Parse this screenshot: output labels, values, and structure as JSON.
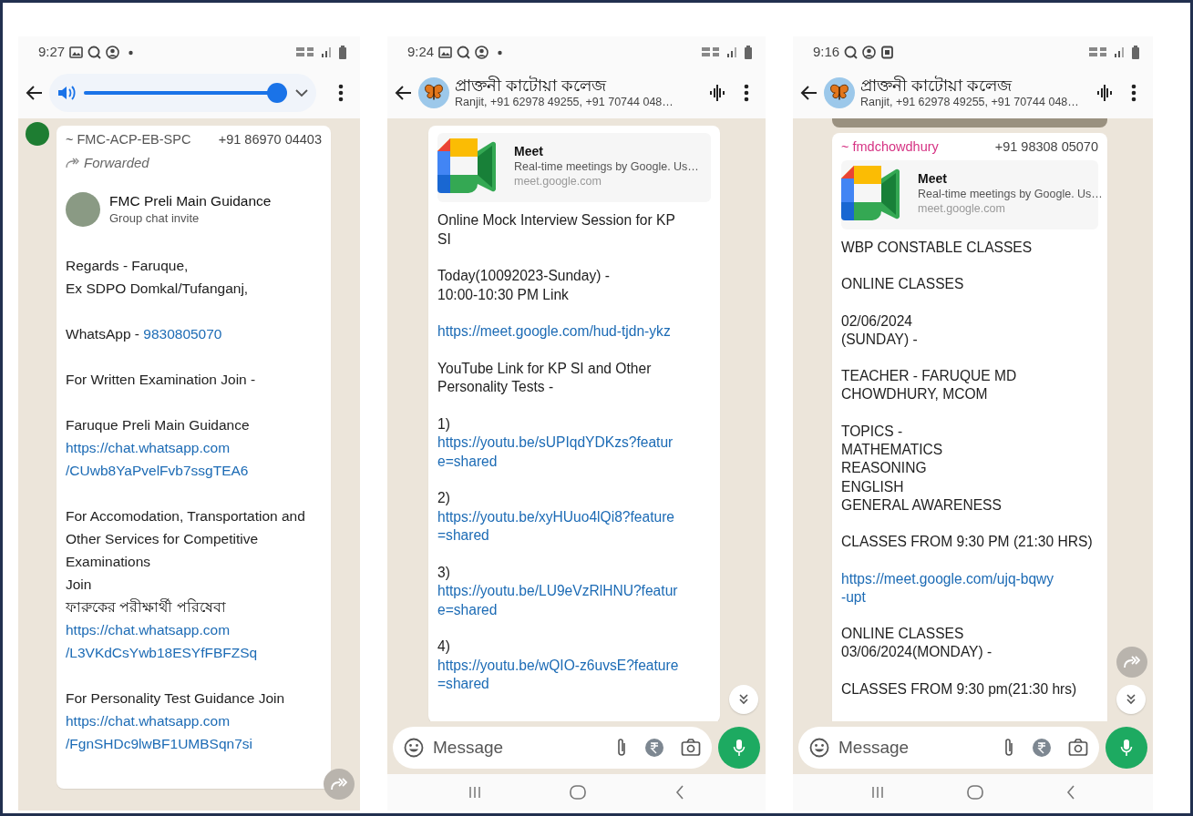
{
  "phones": [
    {
      "status_bar": {
        "time": "9:27",
        "icons": [
          {
            "kind": "gallery"
          },
          {
            "kind": "search"
          },
          {
            "kind": "account"
          },
          {
            "kind": "dot"
          }
        ]
      },
      "volume": {
        "level": 1
      },
      "message": {
        "sender": "~ FMC-ACP-EB-SPC",
        "sender_phone": "+91 86970 04403",
        "color": "#555555",
        "forwarded_label": "Forwarded",
        "invite": {
          "title": "FMC Preli Main Guidance",
          "subtitle": "Group chat invite"
        },
        "paragraphs": [
          [
            {
              "kind": "text",
              "text": "Regards - Faruque,"
            },
            {
              "kind": "text",
              "text": "Ex SDPO Domkal/Tufanganj,"
            }
          ],
          [
            {
              "kind": "mixed",
              "parts": [
                {
                  "kind": "text",
                  "text": "WhatsApp - "
                },
                {
                  "kind": "link",
                  "text": "9830805070"
                }
              ]
            }
          ],
          [
            {
              "kind": "text",
              "text": "For Written Examination Join -"
            }
          ],
          [
            {
              "kind": "text",
              "text": "Faruque Preli Main Guidance"
            },
            {
              "kind": "link",
              "text": "https://chat.whatsapp.com"
            },
            {
              "kind": "link",
              "text": "/CUwb8YaPvelFvb7ssgTEA6"
            }
          ],
          [
            {
              "kind": "text",
              "text": "For Accomodation, Transportation and"
            },
            {
              "kind": "text",
              "text": "Other Services for Competitive"
            },
            {
              "kind": "text",
              "text": "Examinations"
            },
            {
              "kind": "text",
              "text": "Join"
            },
            {
              "kind": "text",
              "text": "ফারুকের পরীক্ষার্থী পরিষেবা"
            },
            {
              "kind": "link",
              "text": "https://chat.whatsapp.com"
            },
            {
              "kind": "link",
              "text": "/L3VKdCsYwb18ESYfFBFZSq"
            }
          ],
          [
            {
              "kind": "text",
              "text": "For Personality Test Guidance Join"
            },
            {
              "kind": "link",
              "text": "https://chat.whatsapp.com"
            },
            {
              "kind": "link",
              "text": "/FgnSHDc9lwBF1UMBSqn7si"
            }
          ]
        ]
      },
      "forward_button": true
    },
    {
      "status_bar": {
        "time": "9:24",
        "icons": [
          {
            "kind": "gallery"
          },
          {
            "kind": "search"
          },
          {
            "kind": "account"
          },
          {
            "kind": "dot"
          }
        ]
      },
      "header": {
        "title": "প্রাক্তনী কাটোয়া কলেজ",
        "subtitle": "Ranjit, +91 62978 49255, +91 70744 048…"
      },
      "message": {
        "preview": {
          "title": "Meet",
          "description": "Real-time meetings by Google. Us…",
          "domain": "meet.google.com"
        },
        "paragraphs": [
          [
            {
              "kind": "text",
              "text": "Online Mock Interview Session for KP"
            },
            {
              "kind": "text",
              "text": "SI"
            }
          ],
          [
            {
              "kind": "text",
              "text": "Today(10092023-Sunday)  -"
            },
            {
              "kind": "text",
              "text": "10:00-10:30 PM Link"
            }
          ],
          [
            {
              "kind": "link",
              "text": "https://meet.google.com/hud-tjdn-ykz"
            }
          ],
          [
            {
              "kind": "text",
              "text": "YouTube Link for KP SI and Other"
            },
            {
              "kind": "text",
              "text": "Personality Tests -"
            }
          ],
          [
            {
              "kind": "text",
              "text": "1)"
            },
            {
              "kind": "link",
              "text": "https://youtu.be/sUPIqdYDKzs?featur"
            },
            {
              "kind": "link",
              "text": "e=shared"
            }
          ],
          [
            {
              "kind": "text",
              "text": "2)"
            },
            {
              "kind": "link",
              "text": "https://youtu.be/xyHUuo4lQi8?feature"
            },
            {
              "kind": "link",
              "text": "=shared"
            }
          ],
          [
            {
              "kind": "text",
              "text": "3)"
            },
            {
              "kind": "link",
              "text": "https://youtu.be/LU9eVzRlHNU?featur"
            },
            {
              "kind": "link",
              "text": "e=shared"
            }
          ],
          [
            {
              "kind": "text",
              "text": "4)"
            },
            {
              "kind": "link",
              "text": "https://youtu.be/wQIO-z6uvsE?feature"
            },
            {
              "kind": "link",
              "text": "=shared"
            }
          ]
        ]
      },
      "scroll_down_button": true,
      "composer": {
        "placeholder": "Message"
      }
    },
    {
      "status_bar": {
        "time": "9:16",
        "icons": [
          {
            "kind": "search"
          },
          {
            "kind": "account"
          },
          {
            "kind": "screen"
          }
        ]
      },
      "header": {
        "title": "প্রাক্তনী কাটোয়া কলেজ",
        "subtitle": "Ranjit, +91 62978 49255, +91 70744 048…"
      },
      "image_above": true,
      "message": {
        "sender": "~ fmdchowdhury",
        "sender_phone": "+91 98308 05070",
        "color": "#d63384",
        "preview": {
          "title": "Meet",
          "description": "Real-time meetings by Google. Us…",
          "domain": "meet.google.com"
        },
        "paragraphs": [
          [
            {
              "kind": "text",
              "text": "WBP CONSTABLE CLASSES"
            }
          ],
          [
            {
              "kind": "text",
              "text": "ONLINE CLASSES"
            }
          ],
          [
            {
              "kind": "text",
              "text": "02/06/2024"
            },
            {
              "kind": "text",
              "text": " (SUNDAY) -"
            }
          ],
          [
            {
              "kind": "text",
              "text": "TEACHER - FARUQUE MD"
            },
            {
              "kind": "text",
              "text": "CHOWDHURY, MCOM"
            }
          ],
          [
            {
              "kind": "text",
              "text": "TOPICS -"
            },
            {
              "kind": "text",
              "text": "MATHEMATICS"
            },
            {
              "kind": "text",
              "text": "REASONING"
            },
            {
              "kind": "text",
              "text": "ENGLISH"
            },
            {
              "kind": "text",
              "text": "GENERAL AWARENESS"
            }
          ],
          [
            {
              "kind": "text",
              "text": "CLASSES FROM 9:30 PM (21:30 HRS)"
            }
          ],
          [
            {
              "kind": "link",
              "text": "https://meet.google.com/ujq-bqwy"
            },
            {
              "kind": "link",
              "text": "-upt"
            }
          ],
          [
            {
              "kind": "text",
              "text": "ONLINE CLASSES"
            },
            {
              "kind": "text",
              "text": "03/06/2024(MONDAY) -"
            }
          ],
          [
            {
              "kind": "text",
              "text": "CLASSES FROM 9:30 pm(21:30 hrs)"
            }
          ]
        ]
      },
      "forward_button": true,
      "scroll_down_button": true,
      "composer": {
        "placeholder": "Message"
      }
    }
  ]
}
